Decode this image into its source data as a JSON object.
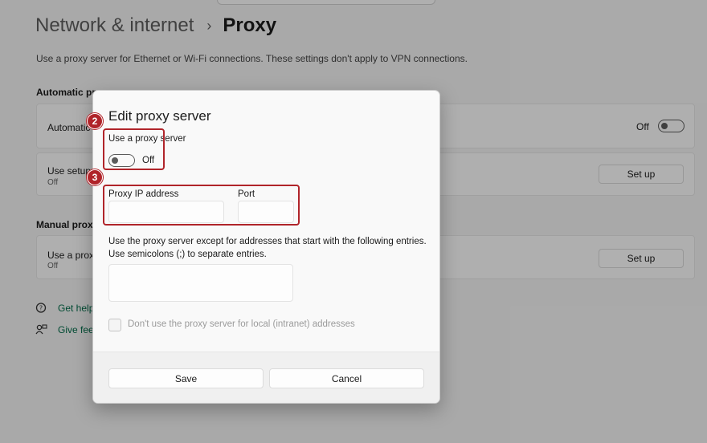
{
  "breadcrumb": {
    "parent": "Network & internet",
    "separator": "›",
    "current": "Proxy"
  },
  "description": "Use a proxy server for Ethernet or Wi-Fi connections. These settings don't apply to VPN connections.",
  "automatic": {
    "heading": "Automatic pro",
    "detect": {
      "label": "Automatic",
      "toggle_state": "Off"
    },
    "setup_script": {
      "label": "Use setup",
      "sub": "Off",
      "button": "Set up"
    }
  },
  "manual": {
    "heading": "Manual proxy",
    "use_proxy": {
      "label": "Use a proxy",
      "sub": "Off",
      "button": "Set up"
    }
  },
  "links": [
    {
      "label": "Get help",
      "icon": "help-chat-icon"
    },
    {
      "label": "Give feedback",
      "icon": "feedback-icon"
    }
  ],
  "dialog": {
    "title": "Edit proxy server",
    "use_proxy_label": "Use a proxy server",
    "toggle_state": "Off",
    "proxy_ip_label": "Proxy IP address",
    "proxy_ip_value": "",
    "port_label": "Port",
    "port_value": "",
    "exceptions_text_1": "Use the proxy server except for addresses that start with the following entries.",
    "exceptions_text_2": "Use semicolons (;) to separate entries.",
    "exceptions_value": "",
    "local_checkbox_label": "Don't use the proxy server for local (intranet) addresses",
    "local_checkbox_checked": false,
    "save_label": "Save",
    "cancel_label": "Cancel"
  },
  "annotations": [
    {
      "number": "2"
    },
    {
      "number": "3"
    }
  ],
  "colors": {
    "accent_link": "#006b48",
    "marker": "#b0242a"
  }
}
